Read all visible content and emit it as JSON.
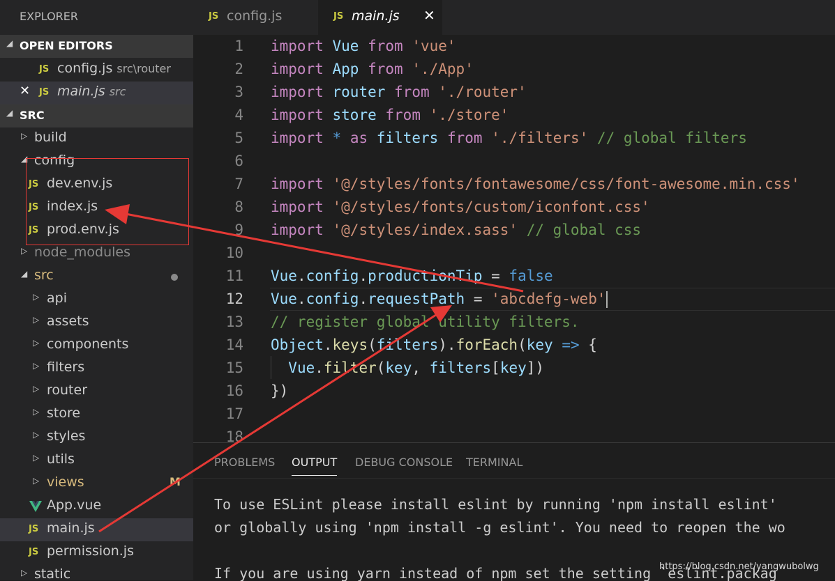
{
  "explorer": {
    "title": "EXPLORER"
  },
  "open_editors": {
    "heading": "OPEN EDITORS",
    "items": [
      {
        "name": "config.js",
        "path": "src\\router"
      },
      {
        "name": "main.js",
        "path": "src"
      }
    ]
  },
  "src_section": {
    "heading": "SRC"
  },
  "tree": {
    "build": "build",
    "config": "config",
    "dev_env": "dev.env.js",
    "index": "index.js",
    "prod_env": "prod.env.js",
    "node_modules": "node_modules",
    "src": "src",
    "api": "api",
    "assets": "assets",
    "components": "components",
    "filters": "filters",
    "router": "router",
    "store": "store",
    "styles": "styles",
    "utils": "utils",
    "views": "views",
    "views_badge": "M",
    "app_vue": "App.vue",
    "main_js": "main.js",
    "permission_js": "permission.js",
    "static": "static"
  },
  "icons": {
    "js_glyph": "JS",
    "close_glyph": "✕",
    "close_tab_glyph": "✕"
  },
  "tabs": [
    {
      "label": "config.js"
    },
    {
      "label": "main.js"
    }
  ],
  "line_numbers": [
    "1",
    "2",
    "3",
    "4",
    "5",
    "6",
    "7",
    "8",
    "9",
    "10",
    "11",
    "12",
    "13",
    "14",
    "15",
    "16",
    "17",
    "18"
  ],
  "code": {
    "import": "import",
    "from": "from",
    "as": "as",
    "star": "*",
    "l1": {
      "name": "Vue",
      "str": "'vue'"
    },
    "l2": {
      "name": "App",
      "str": "'./App'"
    },
    "l3": {
      "name": "router",
      "str": "'./router'"
    },
    "l4": {
      "name": "store",
      "str": "'./store'"
    },
    "l5": {
      "name": "filters",
      "str": "'./filters'",
      "comment": "// global filters"
    },
    "l7": {
      "str": "'@/styles/fonts/fontawesome/css/font-awesome.min.css'"
    },
    "l8": {
      "str": "'@/styles/fonts/custom/iconfont.css'"
    },
    "l9": {
      "str": "'@/styles/index.sass'",
      "comment": "// global css"
    },
    "l11": {
      "obj": "Vue",
      "p1": "config",
      "p2": "productionTip",
      "eq": " = ",
      "val": "false"
    },
    "l12": {
      "obj": "Vue",
      "p1": "config",
      "p2": "requestPath",
      "eq": " = ",
      "val": "'abcdefg-web'"
    },
    "l13": {
      "comment": "// register global utility filters."
    },
    "l14": {
      "obj": "Object",
      "fn1": "keys",
      "arg": "filters",
      "fn2": "forEach",
      "param": "key",
      "arrow": "=>"
    },
    "l15": {
      "obj": "Vue",
      "fn": "filter",
      "a1": "key",
      "a2": "filters",
      "a3": "key"
    },
    "l16": {
      "text": "})"
    }
  },
  "panel": {
    "tabs": [
      "PROBLEMS",
      "OUTPUT",
      "DEBUG CONSOLE",
      "TERMINAL"
    ],
    "active_tab": "OUTPUT",
    "lines": [
      "To use ESLint please install eslint by running 'npm install eslint'",
      "or globally using 'npm install -g eslint'. You need to reopen the wo",
      "If you are using yarn instead of npm set the setting `eslint.packag"
    ]
  },
  "watermark": "https://blog.csdn.net/yangwubolwg",
  "colors": {
    "annotation_red": "#e53935",
    "js_yellow": "#cbcb41",
    "vue_green": "#41b883"
  }
}
